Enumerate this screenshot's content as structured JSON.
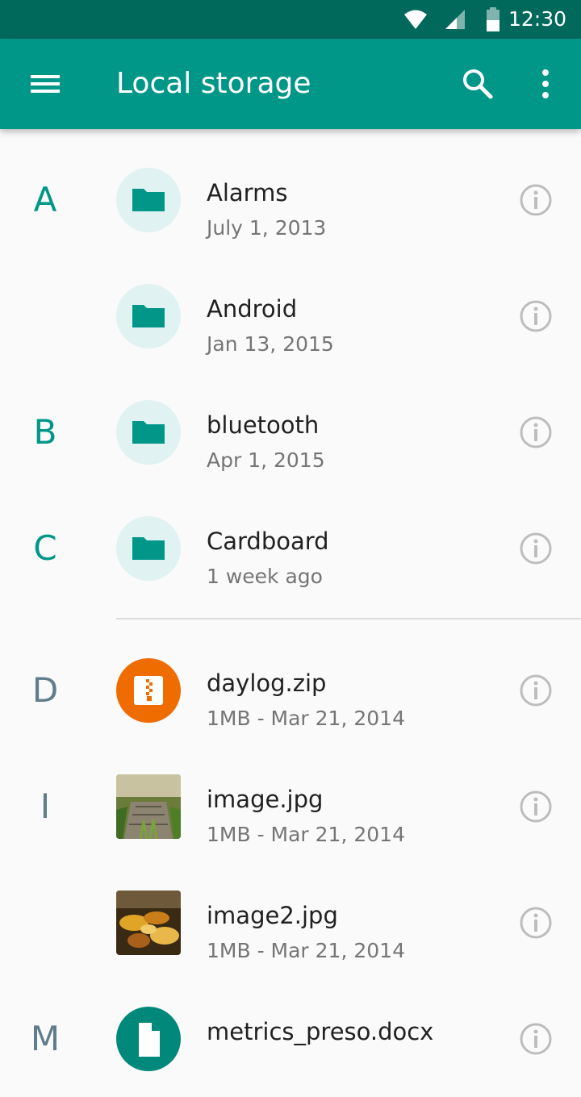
{
  "status_bar": {
    "time": "12:30",
    "icons": [
      "wifi-icon",
      "cell-signal-icon",
      "battery-icon"
    ]
  },
  "app_bar": {
    "title": "Local storage",
    "icons": [
      "menu-icon",
      "search-icon",
      "more-vert-icon"
    ],
    "color": "#009688",
    "status_color": "#00695c"
  },
  "files": [
    {
      "letter": "A",
      "name": "Alarms",
      "meta": "July 1, 2013",
      "kind": "folder"
    },
    {
      "letter": "",
      "name": "Android",
      "meta": "Jan 13, 2015",
      "kind": "folder"
    },
    {
      "letter": "B",
      "name": "bluetooth",
      "meta": "Apr 1, 2015",
      "kind": "folder"
    },
    {
      "letter": "C",
      "name": "Cardboard",
      "meta": "1 week ago",
      "kind": "folder"
    },
    {
      "letter": "D",
      "name": "daylog.zip",
      "meta": "1MB - Mar 21, 2014",
      "kind": "zip"
    },
    {
      "letter": "I",
      "name": "image.jpg",
      "meta": "1MB - Mar 21, 2014",
      "kind": "image"
    },
    {
      "letter": "",
      "name": "image2.jpg",
      "meta": "1MB - Mar 21, 2014",
      "kind": "image"
    },
    {
      "letter": "M",
      "name": "metrics_preso.docx",
      "meta": "",
      "kind": "document"
    }
  ],
  "colors": {
    "accent": "#009688",
    "folder_bg": "#e0f2f1",
    "zip": "#ef6c00",
    "letter_grey": "#607d8b"
  }
}
